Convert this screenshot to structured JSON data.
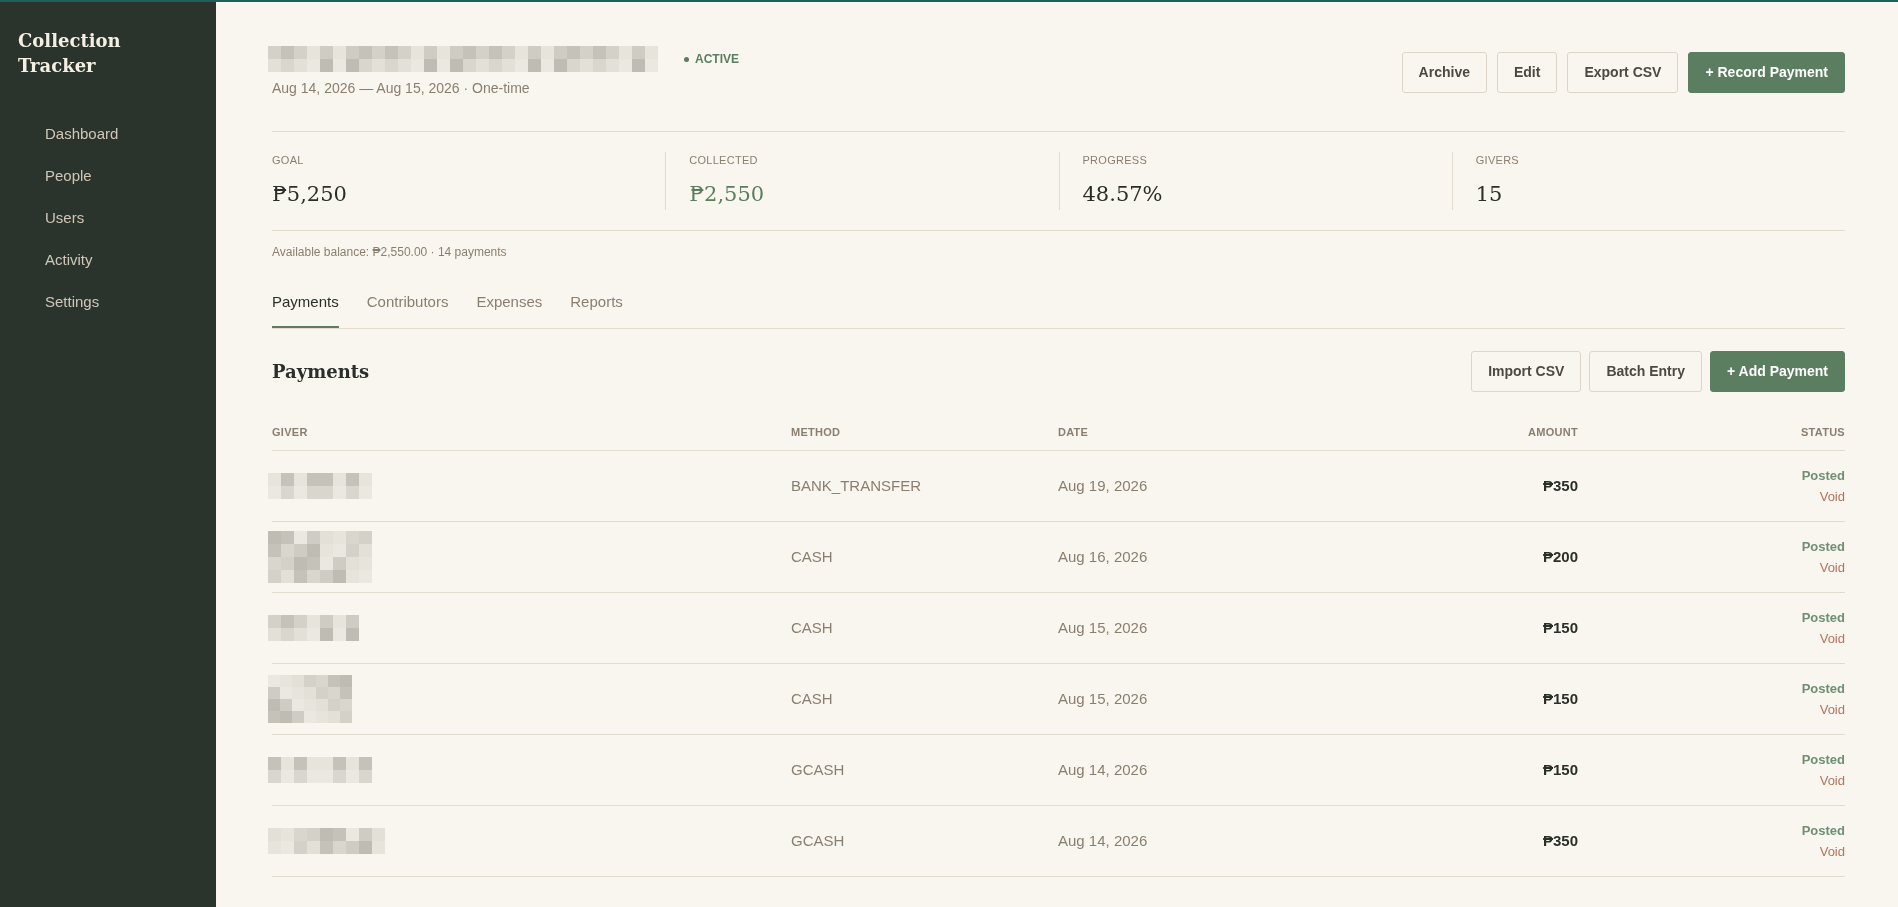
{
  "sidebar": {
    "brand": "Collection Tracker",
    "items": [
      {
        "label": "Dashboard",
        "selected": false
      },
      {
        "label": "People",
        "selected": false
      },
      {
        "label": "Users",
        "selected": false
      },
      {
        "label": "Activity",
        "selected": false
      },
      {
        "label": "Settings",
        "selected": false
      }
    ]
  },
  "header": {
    "status": "ACTIVE",
    "subtitle": "Aug 14, 2026 — Aug 15, 2026 · One-time",
    "actions": [
      {
        "label": "Archive",
        "kind": "outline"
      },
      {
        "label": "Edit",
        "kind": "outline"
      },
      {
        "label": "Export CSV",
        "kind": "outline"
      },
      {
        "label": "+ Record Payment",
        "kind": "primary"
      }
    ]
  },
  "stats": [
    {
      "label": "GOAL",
      "value": "₱5,250",
      "kind": "plain"
    },
    {
      "label": "COLLECTED",
      "value": "₱2,550",
      "kind": "accent"
    },
    {
      "label": "PROGRESS",
      "value": "48.57%",
      "kind": "plain"
    },
    {
      "label": "GIVERS",
      "value": "15",
      "kind": "plain"
    }
  ],
  "balance_note": "Available balance: ₱2,550.00 · 14 payments",
  "tabs": [
    {
      "label": "Payments",
      "selected": true
    },
    {
      "label": "Contributors",
      "selected": false
    },
    {
      "label": "Expenses",
      "selected": false
    },
    {
      "label": "Reports",
      "selected": false
    }
  ],
  "payments": {
    "title": "Payments",
    "actions": [
      {
        "label": "Import CSV",
        "kind": "outline"
      },
      {
        "label": "Batch Entry",
        "kind": "outline"
      },
      {
        "label": "+ Add Payment",
        "kind": "primary"
      }
    ],
    "columns": [
      "GIVER",
      "METHOD",
      "DATE",
      "AMOUNT",
      "STATUS"
    ],
    "rows": [
      {
        "method": "BANK_TRANSFER",
        "date": "Aug 19, 2026",
        "amount": "₱350",
        "status": "Posted",
        "action": "Void"
      },
      {
        "method": "CASH",
        "date": "Aug 16, 2026",
        "amount": "₱200",
        "status": "Posted",
        "action": "Void"
      },
      {
        "method": "CASH",
        "date": "Aug 15, 2026",
        "amount": "₱150",
        "status": "Posted",
        "action": "Void"
      },
      {
        "method": "CASH",
        "date": "Aug 15, 2026",
        "amount": "₱150",
        "status": "Posted",
        "action": "Void"
      },
      {
        "method": "GCASH",
        "date": "Aug 14, 2026",
        "amount": "₱150",
        "status": "Posted",
        "action": "Void"
      },
      {
        "method": "GCASH",
        "date": "Aug 14, 2026",
        "amount": "₱350",
        "status": "Posted",
        "action": "Void"
      }
    ]
  }
}
